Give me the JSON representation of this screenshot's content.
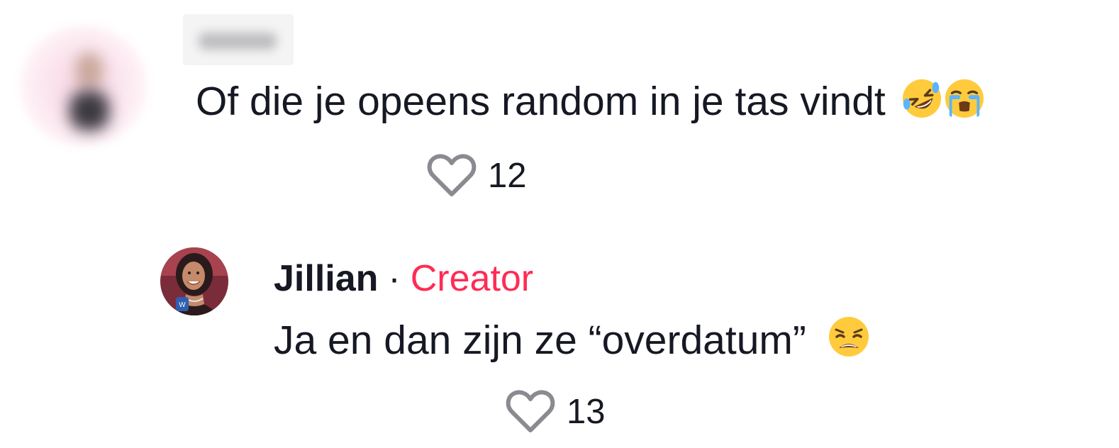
{
  "comments": [
    {
      "username": "",
      "text": "Of die je opeens random in je tas vindt",
      "emojis": [
        "rolling-on-floor-laughing-emoji",
        "loudly-crying-emoji"
      ],
      "likes": "12"
    },
    {
      "username": "Jillian",
      "separator": "·",
      "badge": "Creator",
      "text": "Ja en dan zijn ze “overdatum”",
      "emojis": [
        "weary-face-emoji"
      ],
      "likes": "13"
    }
  ],
  "colors": {
    "text": "#161823",
    "creator_badge": "#fe2c55",
    "heart_outline": "#8a8b91"
  }
}
